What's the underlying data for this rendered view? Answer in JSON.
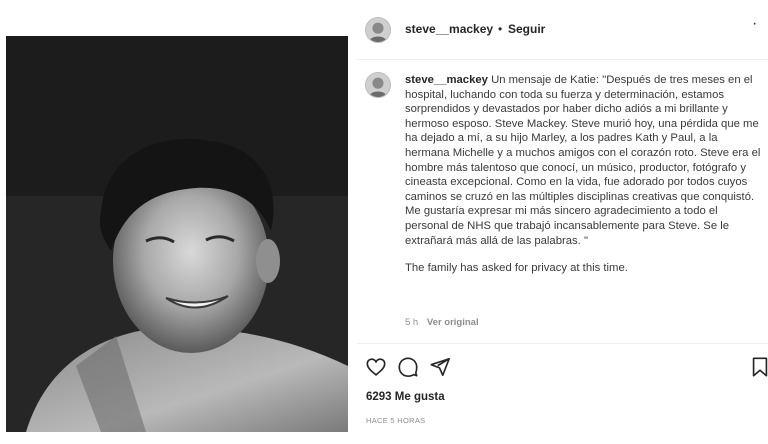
{
  "header": {
    "username": "steve__mackey",
    "separator": "•",
    "follow_label": "Seguir",
    "more_icon": "more-dots-icon"
  },
  "caption": {
    "username": "steve__mackey",
    "text": "Un mensaje de Katie: \"Después de tres meses en el hospital, luchando con toda su fuerza y determinación, estamos sorprendidos y devastados por haber dicho adiós a mi brillante y hermoso esposo. Steve Mackey. Steve murió hoy, una pérdida que me ha dejado a mí, a su hijo Marley, a los padres Kath y Paul, a la hermana Michelle y a muchos amigos con el corazón roto. Steve era el hombre más talentoso que conocí, un músico, productor, fotógrafo y cineasta excepcional. Como en la vida, fue adorado por todos cuyos caminos se cruzó en las múltiples disciplinas creativas que conquistó. Me gustaría expresar mi más sincero agradecimiento a todo el personal de NHS que trabajó incansablemente para Steve. Se le extrañará más allá de las palabras. \"",
    "privacy_note": "The family has asked for privacy at this time.",
    "age": "5 h",
    "see_original": "Ver original"
  },
  "actions": {
    "like_icon": "heart-icon",
    "comment_icon": "comment-icon",
    "share_icon": "send-icon",
    "save_icon": "bookmark-icon"
  },
  "likes_label": "6293 Me gusta",
  "timestamp": "HACE 5 HORAS"
}
